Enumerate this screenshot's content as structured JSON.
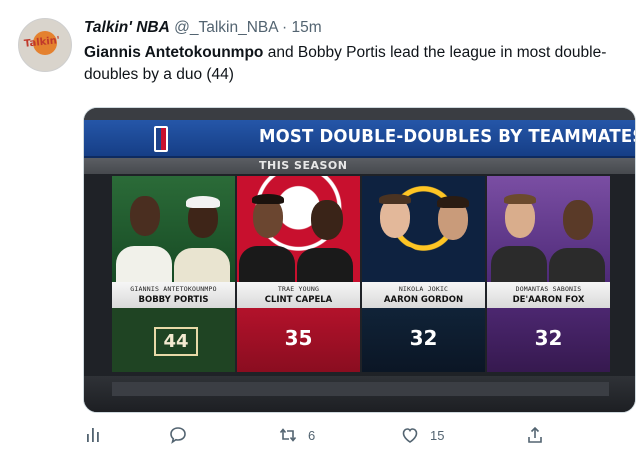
{
  "tweet": {
    "display_name": "Talkin' NBA",
    "handle": "@_Talkin_NBA",
    "separator": "·",
    "time": "15m",
    "avatar_text": "Talkin'",
    "text_bold": "Giannis Antetokounmpo",
    "text_rest": " and Bobby Portis lead the league in most double-doubles by a duo (44)"
  },
  "graphic": {
    "title": "MOST DOUBLE-DOUBLES BY TEAMMATES",
    "subtitle": "THIS SEASON",
    "cards": [
      {
        "player1": "GIANNIS ANTETOKOUNMPO",
        "player2": "BOBBY PORTIS",
        "value": "44",
        "top_color": "#1e5a2e",
        "bottom_color": "#1c3d1f",
        "highlight": true
      },
      {
        "player1": "TRAE YOUNG",
        "player2": "CLINT CAPELA",
        "value": "35",
        "top_color": "#c8102e",
        "bottom_color": "#8f0d22",
        "highlight": false
      },
      {
        "player1": "NIKOLA JOKIC",
        "player2": "AARON GORDON",
        "value": "32",
        "top_color": "#0e2240",
        "bottom_color": "#0c1a30",
        "highlight": false
      },
      {
        "player1": "DOMANTAS SABONIS",
        "player2": "DE'AARON FOX",
        "value": "32",
        "top_color": "#5a2d81",
        "bottom_color": "#3e2060",
        "highlight": false
      }
    ]
  },
  "actions": {
    "analytics_icon": "analytics-icon",
    "reply_icon": "reply-icon",
    "retweet_count": "6",
    "like_count": "15",
    "share_icon": "share-icon"
  }
}
